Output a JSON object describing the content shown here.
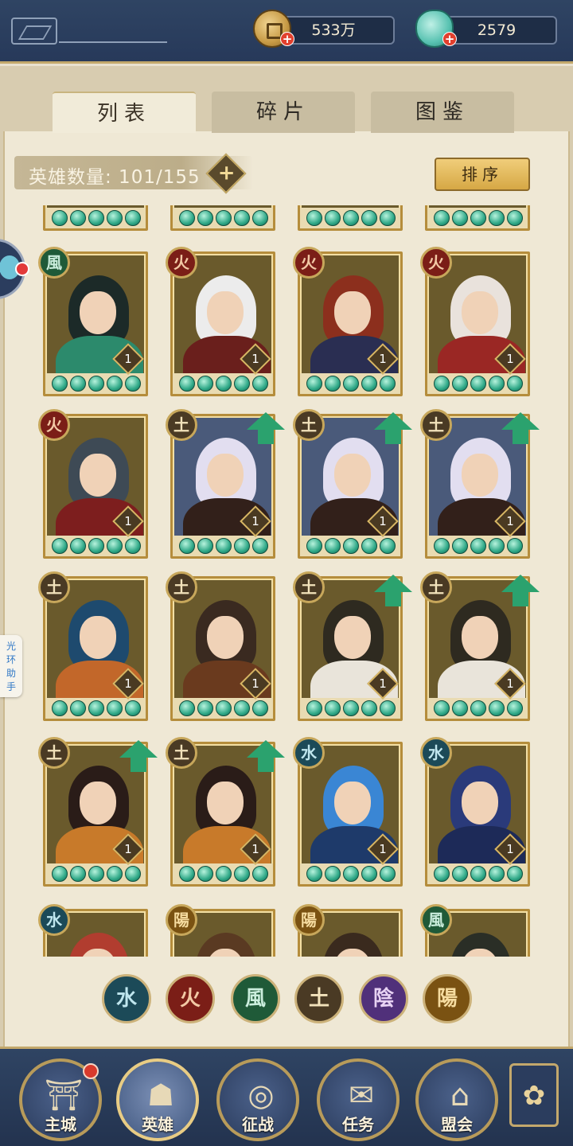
{
  "header": {
    "back_icon": "back-logo-icon",
    "currency": [
      {
        "name": "copper-coin",
        "icon": "coin-icon",
        "value": "533万",
        "plus_icon": "plus-icon"
      },
      {
        "name": "jade",
        "icon": "jade-icon",
        "value": "2579",
        "plus_icon": "plus-icon"
      }
    ]
  },
  "tabs": [
    {
      "label": "列表",
      "active": true
    },
    {
      "label": "碎片",
      "active": false
    },
    {
      "label": "图鉴",
      "active": false
    }
  ],
  "hero_count": {
    "label": "英雄数量: 101/155",
    "plus_icon": "plus-icon"
  },
  "sort_button": "排序",
  "side_helper": "光环助手",
  "elements": {
    "fire": {
      "glyph": "火",
      "color": "#7b1e17"
    },
    "wind": {
      "glyph": "風",
      "color": "#1f5a38"
    },
    "earth": {
      "glyph": "土",
      "color": "#4a3a24"
    },
    "water": {
      "glyph": "水",
      "color": "#1c4a58"
    },
    "yin": {
      "glyph": "陰",
      "color": "#50307a"
    },
    "yang": {
      "glyph": "陽",
      "color": "#7a5212"
    }
  },
  "hero_rows": [
    [
      {
        "element": "wind",
        "level": "1",
        "stars": 5,
        "upgrade": false,
        "bg": "#6a5a2c",
        "hair": "#1c2a28",
        "body": "#2c8a6c"
      },
      {
        "element": "fire",
        "level": "1",
        "stars": 5,
        "upgrade": false,
        "bg": "#6a5a2c",
        "hair": "#ececec",
        "body": "#6a1f1c"
      },
      {
        "element": "fire",
        "level": "1",
        "stars": 5,
        "upgrade": false,
        "bg": "#6a5a2c",
        "hair": "#8c2f1d",
        "body": "#2a2e52"
      },
      {
        "element": "fire",
        "level": "1",
        "stars": 5,
        "upgrade": false,
        "bg": "#6a5a2c",
        "hair": "#e9e2dc",
        "body": "#9a2724"
      }
    ],
    [
      {
        "element": "fire",
        "level": "1",
        "stars": 5,
        "upgrade": false,
        "bg": "#6a5a2c",
        "hair": "#3e4a55",
        "body": "#7d1e1e"
      },
      {
        "element": "earth",
        "level": "1",
        "stars": 5,
        "upgrade": true,
        "bg": "#4a5a7a",
        "hair": "#e2def0",
        "body": "#32201a"
      },
      {
        "element": "earth",
        "level": "1",
        "stars": 5,
        "upgrade": true,
        "bg": "#4a5a7a",
        "hair": "#e2def0",
        "body": "#32201a"
      },
      {
        "element": "earth",
        "level": "1",
        "stars": 5,
        "upgrade": true,
        "bg": "#4a5a7a",
        "hair": "#e2def0",
        "body": "#32201a"
      }
    ],
    [
      {
        "element": "earth",
        "level": "1",
        "stars": 5,
        "upgrade": false,
        "bg": "#6a5a2c",
        "hair": "#1e4a6e",
        "body": "#c2672a"
      },
      {
        "element": "earth",
        "level": "1",
        "stars": 5,
        "upgrade": false,
        "bg": "#6a5a2c",
        "hair": "#3a2a20",
        "body": "#6a3a1e"
      },
      {
        "element": "earth",
        "level": "1",
        "stars": 5,
        "upgrade": true,
        "bg": "#6a5a2c",
        "hair": "#2e2a20",
        "body": "#e9e4da"
      },
      {
        "element": "earth",
        "level": "1",
        "stars": 5,
        "upgrade": true,
        "bg": "#6a5a2c",
        "hair": "#2e2a20",
        "body": "#e9e4da"
      }
    ],
    [
      {
        "element": "earth",
        "level": "1",
        "stars": 5,
        "upgrade": true,
        "bg": "#6a5a2c",
        "hair": "#2a1c18",
        "body": "#c87a2a"
      },
      {
        "element": "earth",
        "level": "1",
        "stars": 5,
        "upgrade": true,
        "bg": "#6a5a2c",
        "hair": "#2a1c18",
        "body": "#c87a2a"
      },
      {
        "element": "water",
        "level": "1",
        "stars": 5,
        "upgrade": false,
        "bg": "#6a5a2c",
        "hair": "#3a86d4",
        "body": "#1e3a6a"
      },
      {
        "element": "water",
        "level": "1",
        "stars": 5,
        "upgrade": false,
        "bg": "#6a5a2c",
        "hair": "#2a3a7a",
        "body": "#1d2a58"
      }
    ],
    [
      {
        "element": "water",
        "level": "",
        "stars": 0,
        "upgrade": false,
        "bg": "#6a5a2c",
        "hair": "#b13d2f",
        "body": "#c7a243"
      },
      {
        "element": "yang",
        "level": "",
        "stars": 0,
        "upgrade": false,
        "bg": "#6a5a2c",
        "hair": "#5a3a22",
        "body": "#6a4a2a"
      },
      {
        "element": "yang",
        "level": "",
        "stars": 0,
        "upgrade": false,
        "bg": "#6a5a2c",
        "hair": "#3a2a1e",
        "body": "#5a3a2a"
      },
      {
        "element": "wind",
        "level": "",
        "stars": 0,
        "upgrade": false,
        "bg": "#6a5a2c",
        "hair": "#2a2e26",
        "body": "#4a4a3a"
      }
    ]
  ],
  "filters": [
    {
      "element": "water",
      "glyph": "水"
    },
    {
      "element": "fire",
      "glyph": "火"
    },
    {
      "element": "wind",
      "glyph": "風"
    },
    {
      "element": "earth",
      "glyph": "土"
    },
    {
      "element": "yin",
      "glyph": "陰"
    },
    {
      "element": "yang",
      "glyph": "陽"
    }
  ],
  "nav": [
    {
      "label": "主城",
      "icon": "city-gate-icon",
      "active": false,
      "notify": true
    },
    {
      "label": "英雄",
      "icon": "hero-portrait-icon",
      "active": true,
      "notify": false
    },
    {
      "label": "征战",
      "icon": "battle-drum-icon",
      "active": false,
      "notify": false
    },
    {
      "label": "任务",
      "icon": "quest-scroll-icon",
      "active": false,
      "notify": false
    },
    {
      "label": "盟会",
      "icon": "guild-hall-icon",
      "active": false,
      "notify": false
    }
  ],
  "menu_icon": "flower-menu-icon"
}
